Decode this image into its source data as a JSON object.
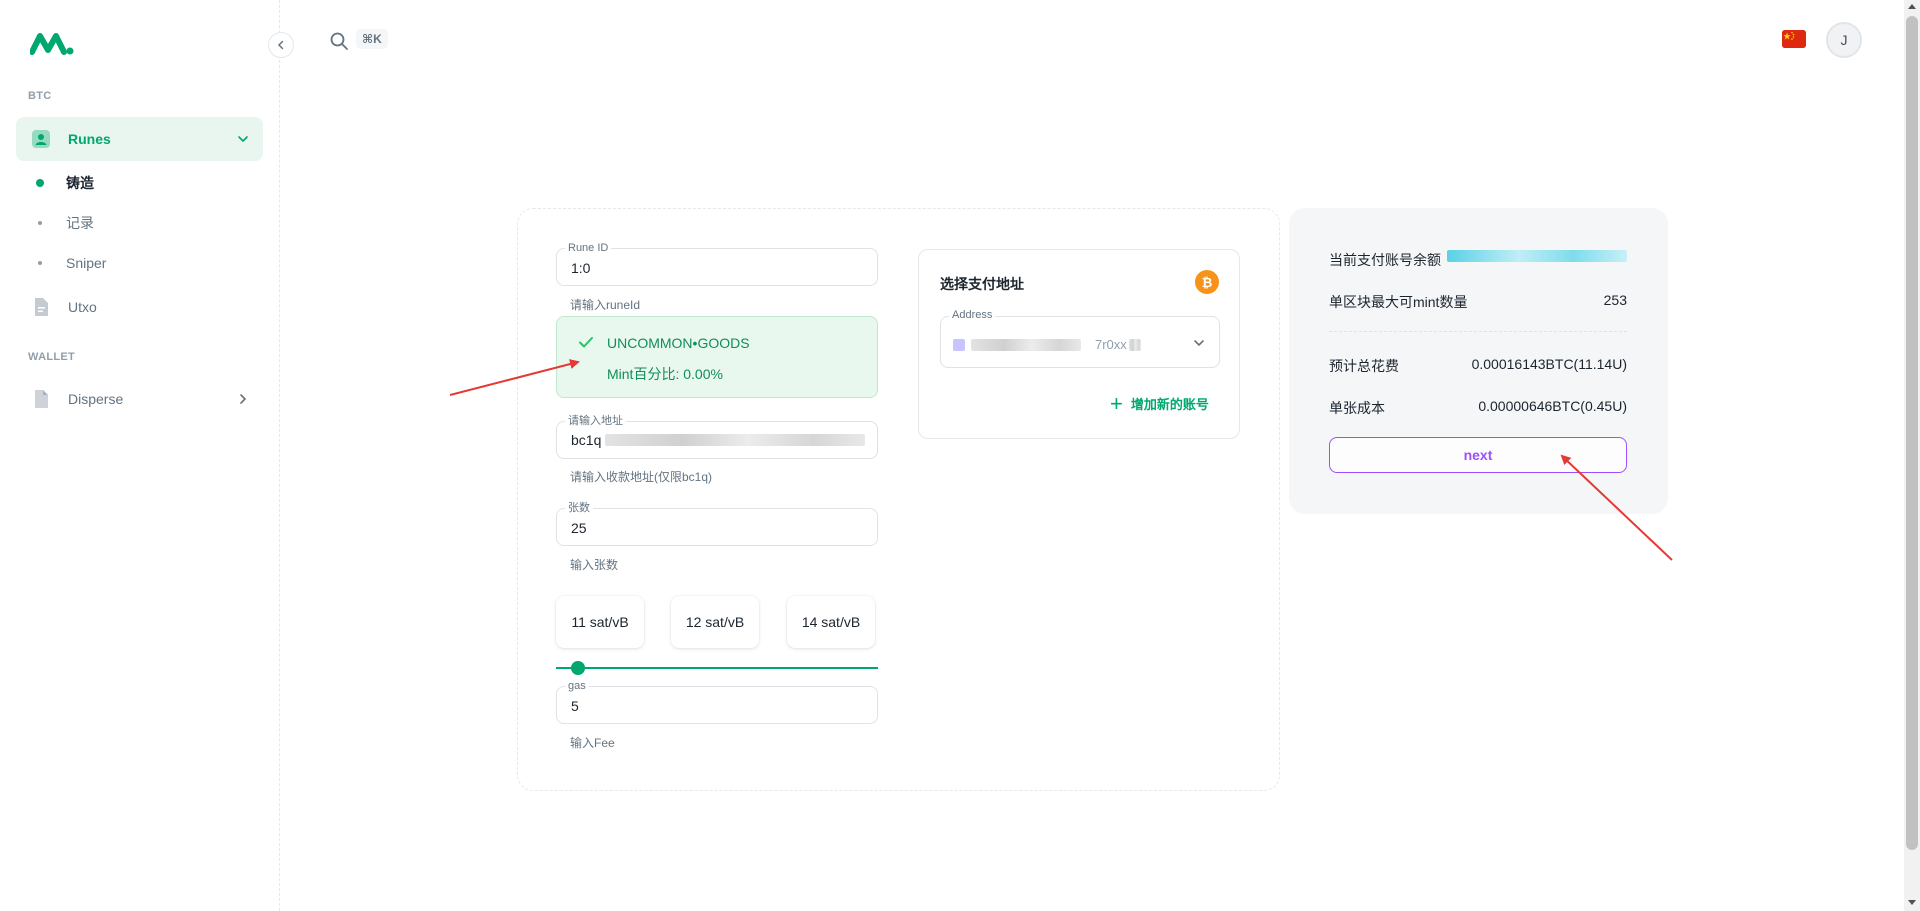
{
  "colors": {
    "accent": "#00a76f",
    "accent_light": "#e8f6ef",
    "purple": "#8e33ff",
    "bitcoin": "#f7931a",
    "annotation": "#e53935"
  },
  "sidebar": {
    "sections": [
      {
        "label": "BTC"
      },
      {
        "label": "WALLET"
      }
    ],
    "items": [
      {
        "label": "Runes",
        "icon": "user-badge-icon",
        "active": true,
        "sub": [
          {
            "label": "铸造",
            "active": true
          },
          {
            "label": "记录"
          },
          {
            "label": "Sniper"
          }
        ]
      },
      {
        "label": "Utxo",
        "icon": "document-icon"
      },
      {
        "label": "Disperse",
        "icon": "file-icon"
      }
    ]
  },
  "header": {
    "shortcut": "⌘K",
    "avatar_initial": "J",
    "flag": "china-flag-icon"
  },
  "form": {
    "rune_id": {
      "label": "Rune ID",
      "value": "1:0",
      "helper": "请输入runeId"
    },
    "rune_info": {
      "name": "UNCOMMON•GOODS",
      "mint_percent": "Mint百分比: 0.00%"
    },
    "address": {
      "label": "请输入地址",
      "value_prefix": "bc1q",
      "helper": "请输入收款地址(仅限bc1q)"
    },
    "count": {
      "label": "张数",
      "value": "25",
      "helper": "输入张数"
    },
    "fee_options": [
      "11 sat/vB",
      "12 sat/vB",
      "14 sat/vB"
    ],
    "gas": {
      "label": "gas",
      "value": "5",
      "helper": "输入Fee"
    }
  },
  "payment": {
    "title": "选择支付地址",
    "address_label": "Address",
    "address_suffix": "7r0xx",
    "add_account": "增加新的账号"
  },
  "summary": {
    "balance_label": "当前支付账号余额",
    "max_mint_label": "单区块最大可mint数量",
    "max_mint_value": "253",
    "total_fee_label": "预计总花费",
    "total_fee_value": "0.00016143BTC(11.14U)",
    "unit_cost_label": "单张成本",
    "unit_cost_value": "0.00000646BTC(0.45U)",
    "next_label": "next"
  }
}
